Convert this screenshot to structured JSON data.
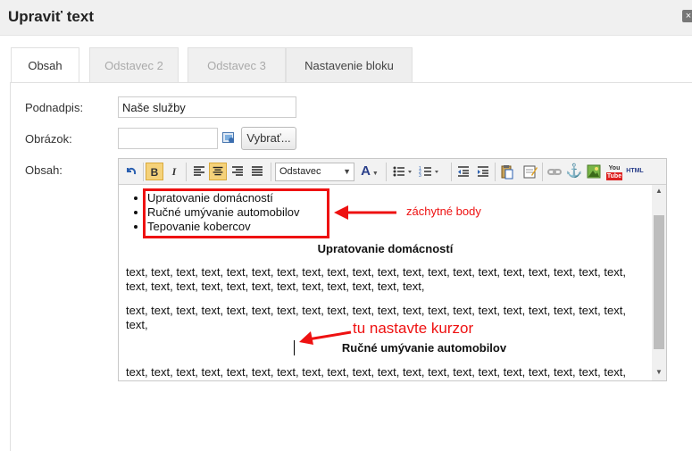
{
  "dialog": {
    "title": "Upraviť text",
    "close_glyph": "×"
  },
  "tabs": [
    {
      "label": "Obsah",
      "active": true
    },
    {
      "label": "Odstavec 2",
      "active": false
    },
    {
      "label": "Odstavec 3",
      "active": false
    },
    {
      "label": "Nastavenie bloku",
      "active": false
    }
  ],
  "form": {
    "subtitle_label": "Podnadpis:",
    "subtitle_value": "Naše služby",
    "image_label": "Obrázok:",
    "image_value": "",
    "choose_button": "Vybrať...",
    "content_label": "Obsah:"
  },
  "toolbar": {
    "format_select": "Odstavec",
    "icons": [
      "undo-icon",
      "bold-icon",
      "italic-icon",
      "align-left-icon",
      "align-center-icon",
      "align-right-icon",
      "align-justify-icon",
      "text-color-icon",
      "bullet-list-icon",
      "numbered-list-icon",
      "outdent-icon",
      "indent-icon",
      "paste-icon",
      "edit-icon",
      "link-icon",
      "anchor-icon",
      "image-icon",
      "youtube-icon",
      "html-icon"
    ],
    "bold_glyph": "B",
    "italic_glyph": "I",
    "text_color_glyph": "A",
    "html_glyph": "HTML",
    "youtube_glyph": "You"
  },
  "content": {
    "list_items": [
      "Upratovanie domácností",
      "Ručné umývanie automobilov",
      "Tepovanie kobercov"
    ],
    "heading1": "Upratovanie domácností",
    "para1": "text, text, text, text, text, text, text, text, text, text, text, text, text, text, text, text, text, text, text, text, text, text, text, text, text, text, text, text, text, text, text, text,",
    "para2": "text, text, text, text, text, text, text, text, text, text, text, text, text, text, text, text, text, text, text, text, text,",
    "heading2": "Ručné umývanie automobilov",
    "para3": "text, text, text, text, text, text, text, text, text, text, text, text, text, text, text, text, text, text, text, text, text, text,"
  },
  "annotations": {
    "anchors": "záchytné body",
    "cursor": "tu nastavte kurzor",
    "color": "#e11111"
  },
  "colors": {
    "accent": "#e11111",
    "title_bar": "#f0f0f0",
    "active_button": "#f5d27a"
  }
}
